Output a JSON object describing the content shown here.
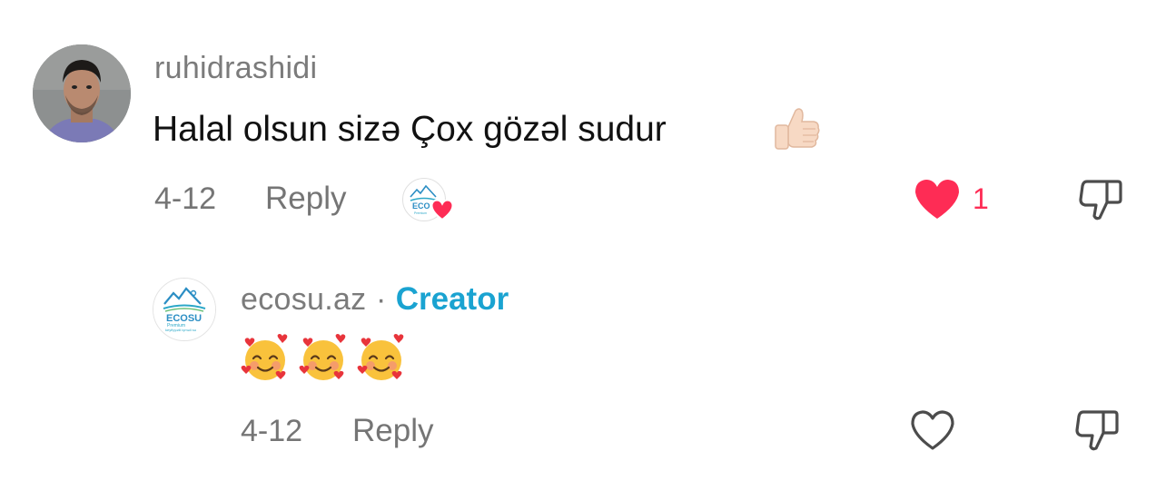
{
  "comment": {
    "username": "ruhidrashidi",
    "text": "Halal olsun sizə Çox gözəl sudur",
    "trailing_emoji": "thumbs-up",
    "date": "4-12",
    "reply_label": "Reply",
    "creator_liked": true,
    "liked": true,
    "like_count": "1"
  },
  "reply": {
    "username": "ecosu.az",
    "separator": "·",
    "badge": "Creator",
    "emojis": [
      "smiling-face-with-hearts",
      "smiling-face-with-hearts",
      "smiling-face-with-hearts"
    ],
    "date": "4-12",
    "reply_label": "Reply",
    "liked": false
  },
  "brand": {
    "logo_text": "ECOSU",
    "logo_subtext": "Premium",
    "logo_tagline": "keyfiyyətli içməli su"
  },
  "colors": {
    "like_active": "#fe2c55",
    "creator_badge": "#1aa3d1",
    "secondary_text": "#757575",
    "primary_text": "#111111"
  }
}
